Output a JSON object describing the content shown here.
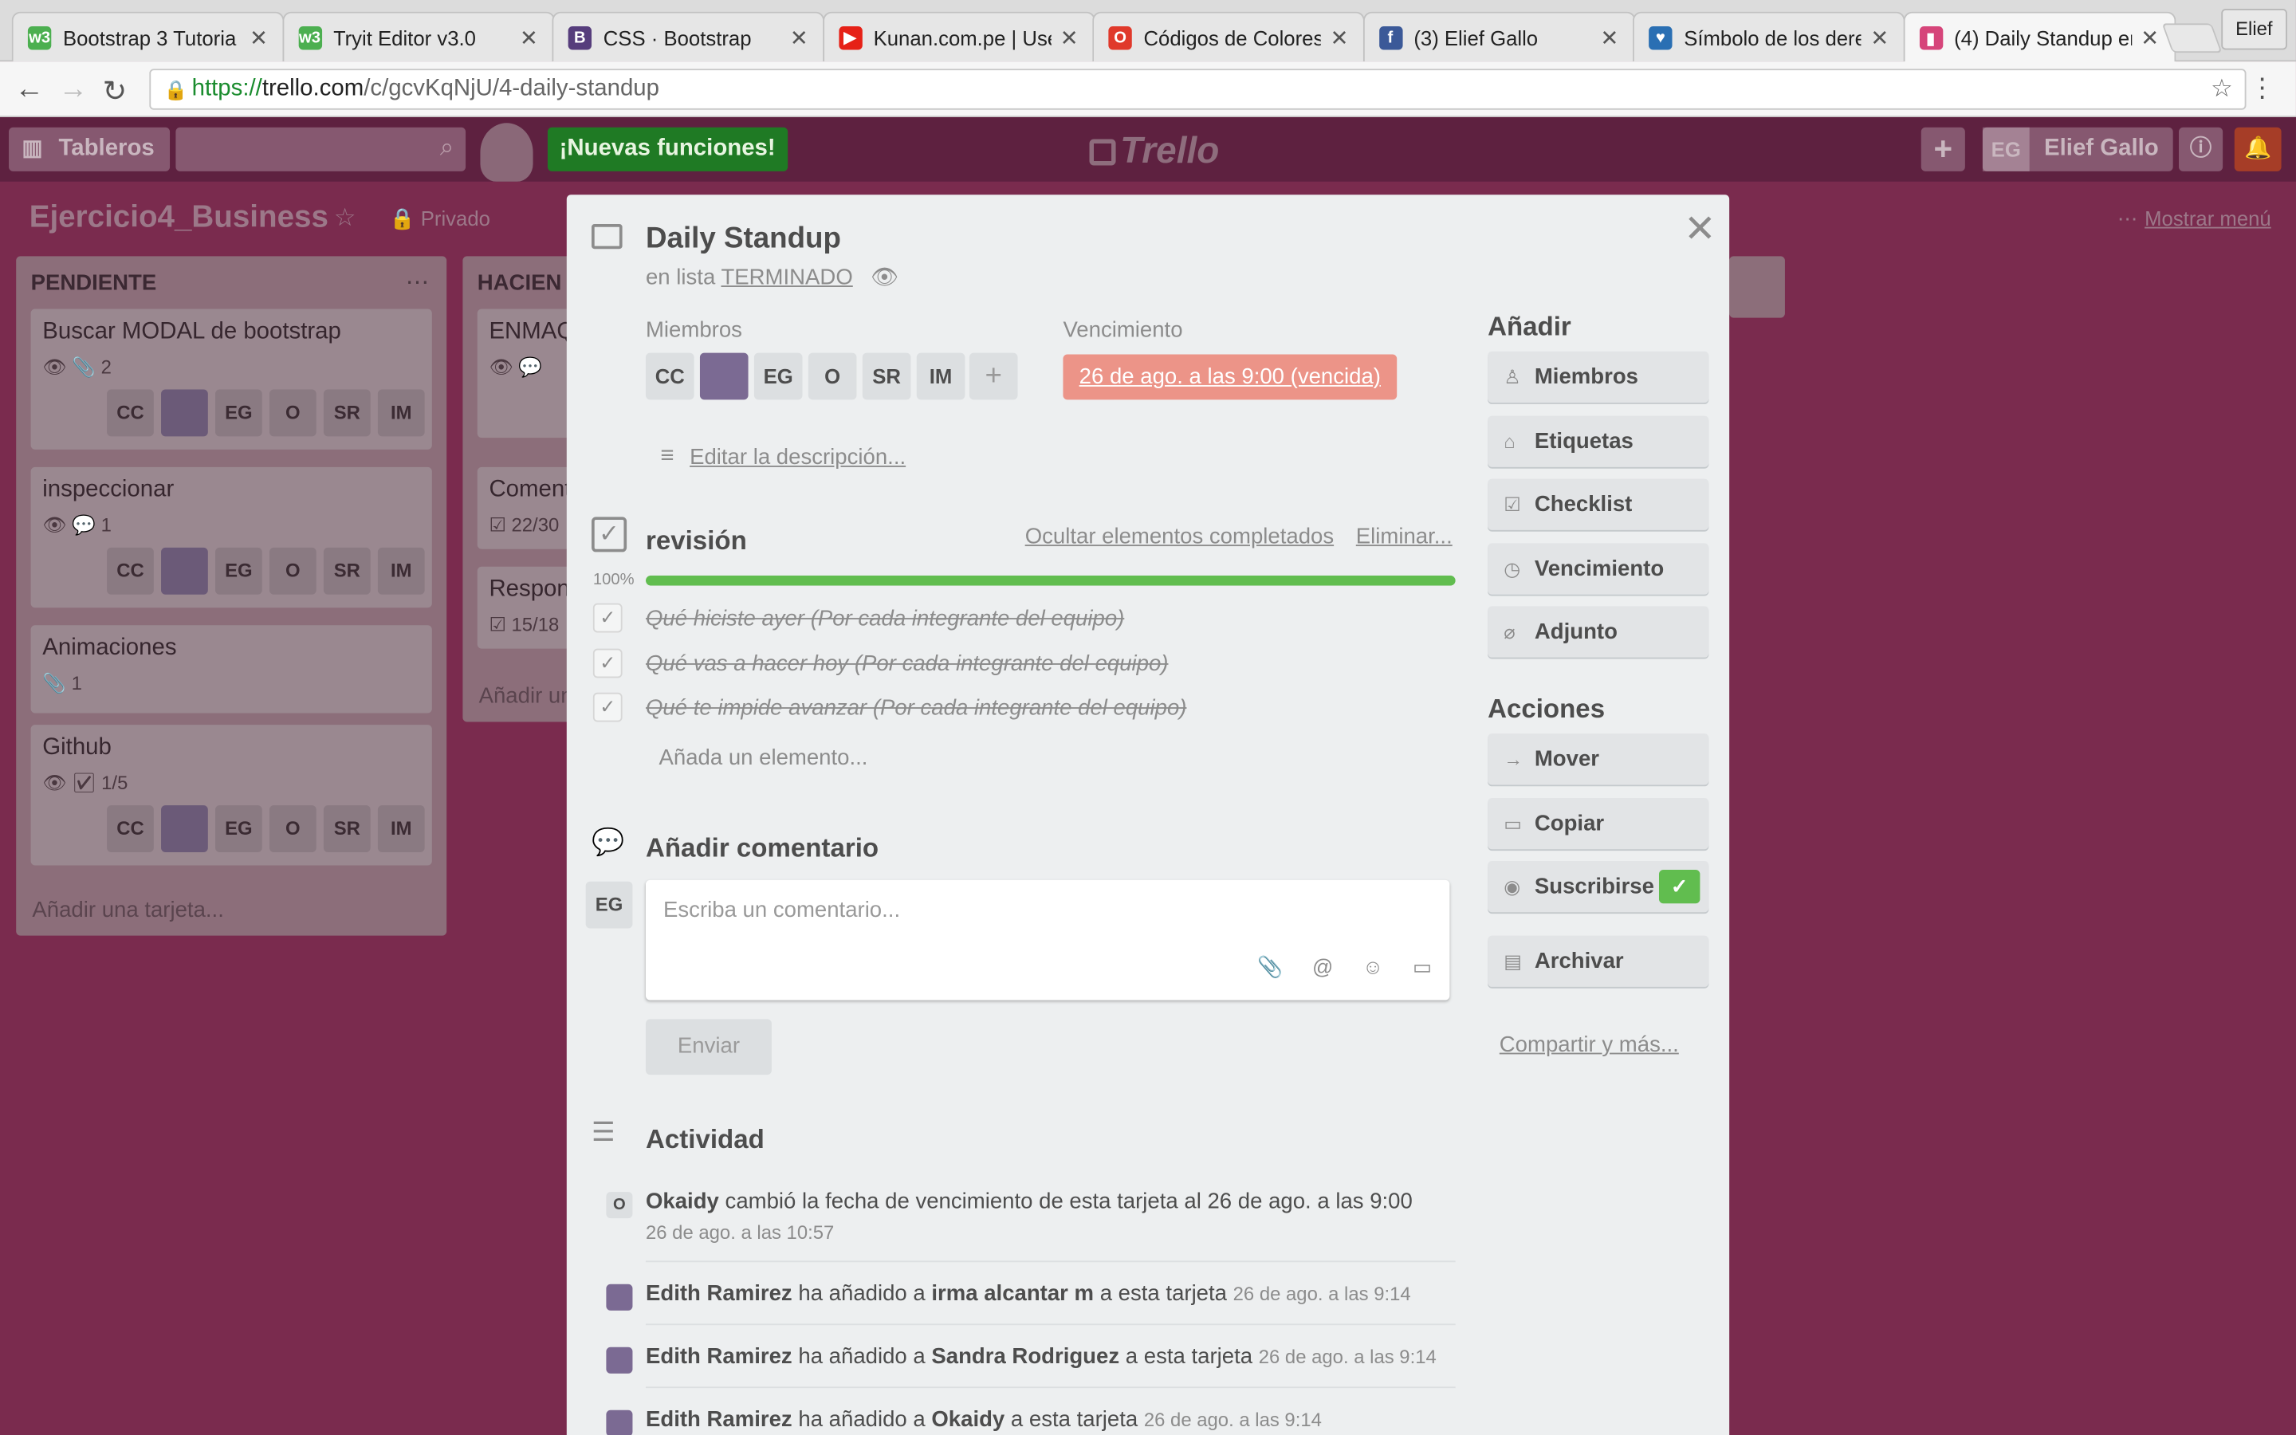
{
  "browser": {
    "tabs": [
      {
        "label": "Bootstrap 3 Tutoria",
        "icon": "w3schools-icon",
        "color": "#4caf50",
        "glyph": "w3"
      },
      {
        "label": "Tryit Editor v3.0",
        "icon": "w3schools-icon",
        "color": "#4caf50",
        "glyph": "w3"
      },
      {
        "label": "CSS · Bootstrap",
        "icon": "bootstrap-icon",
        "color": "#563d7c",
        "glyph": "B"
      },
      {
        "label": "Kunan.com.pe | Use",
        "icon": "youtube-icon",
        "color": "#e62117",
        "glyph": "▶"
      },
      {
        "label": "Códigos de Colores",
        "icon": "opera-icon",
        "color": "#e0392b",
        "glyph": "O"
      },
      {
        "label": "(3) Elief Gallo",
        "icon": "facebook-icon",
        "color": "#3b5998",
        "glyph": "f"
      },
      {
        "label": "Símbolo de los dere",
        "icon": "heart-icon",
        "color": "#2a6fb3",
        "glyph": "♥"
      },
      {
        "label": "(4) Daily Standup er",
        "icon": "trello-icon",
        "color": "#d6457a",
        "glyph": "▮"
      }
    ],
    "profile": "Elief",
    "url": {
      "scheme": "https://",
      "host": "trello.com",
      "path": "/c/gcvKqNjU/4-daily-standup"
    }
  },
  "header": {
    "boards_label": "Tableros",
    "new_features": "¡Nuevas funciones!",
    "logo": "Trello",
    "user_initials": "EG",
    "user_name": "Elief Gallo"
  },
  "board": {
    "title": "Ejercicio4_Business",
    "privacy": "Privado",
    "show_menu": "Mostrar menú",
    "lists": [
      {
        "title": "PENDIENTE",
        "cards": [
          {
            "title": "Buscar MODAL de bootstrap",
            "badges": "👁 📎 2"
          },
          {
            "title": "inspeccionar",
            "badges": "👁 💬 1"
          },
          {
            "title": "Animaciones",
            "badges": "📎 1"
          },
          {
            "title": "Github",
            "badges": "👁 ☑ 1/5"
          }
        ],
        "add_card": "Añadir una tarjeta..."
      },
      {
        "title": "HACIEN",
        "cards": [
          {
            "title": "ENMAQ",
            "badges": "👁 💬"
          },
          {
            "title": "Coment",
            "badges": "☑ 22/30"
          },
          {
            "title": "Respon",
            "badges": "☑ 15/18"
          }
        ],
        "add_card": "Añadir un"
      }
    ],
    "member_chips": [
      "CC",
      "",
      "EG",
      "O",
      "SR",
      "IM"
    ]
  },
  "modal": {
    "title": "Daily Standup",
    "list_prefix": "en lista",
    "list_name": "TERMINADO",
    "members_label": "Miembros",
    "members": [
      "CC",
      "",
      "EG",
      "O",
      "SR",
      "IM"
    ],
    "add_member": "+",
    "due_label": "Vencimiento",
    "due_value": "26 de ago. a las 9:00 (vencida)",
    "edit_description": "Editar la descripción...",
    "checklist": {
      "title": "revisión",
      "hide_completed": "Ocultar elementos completados",
      "delete": "Eliminar...",
      "progress_label": "100%",
      "progress": 1.0,
      "items": [
        "Qué hiciste ayer (Por cada integrante del equipo)",
        "Qué vas a hacer hoy (Por cada integrante del equipo)",
        "Qué te impide avanzar (Por cada integrante del equipo)"
      ],
      "add_item": "Añada un elemento..."
    },
    "comment": {
      "title": "Añadir comentario",
      "author_initials": "EG",
      "placeholder": "Escriba un comentario...",
      "send": "Enviar"
    },
    "activity": {
      "title": "Actividad",
      "entries": [
        {
          "user": "Okaidy",
          "initials": "O",
          "text": "cambió la fecha de vencimiento de esta tarjeta al 26 de ago. a las 9:00",
          "time": "26 de ago. a las 10:57"
        },
        {
          "user": "Edith Ramirez",
          "text": "ha añadido a",
          "target": "irma alcantar m",
          "suffix": "a esta tarjeta",
          "time": "26 de ago. a las 9:14"
        },
        {
          "user": "Edith Ramirez",
          "text": "ha añadido a",
          "target": "Sandra Rodriguez",
          "suffix": "a esta tarjeta",
          "time": "26 de ago. a las 9:14"
        },
        {
          "user": "Edith Ramirez",
          "text": "ha añadido a",
          "target": "Okaidy",
          "suffix": "a esta tarjeta",
          "time": "26 de ago. a las 9:14"
        }
      ]
    },
    "sidebar": {
      "add_title": "Añadir",
      "add_buttons": [
        {
          "label": "Miembros",
          "icon": "person-icon",
          "glyph": "♙"
        },
        {
          "label": "Etiquetas",
          "icon": "tag-icon",
          "glyph": "⌂"
        },
        {
          "label": "Checklist",
          "icon": "checkbox-icon",
          "glyph": "☑"
        },
        {
          "label": "Vencimiento",
          "icon": "clock-icon",
          "glyph": "◷"
        },
        {
          "label": "Adjunto",
          "icon": "paperclip-icon",
          "glyph": "⌀"
        }
      ],
      "actions_title": "Acciones",
      "action_buttons": [
        {
          "label": "Mover",
          "icon": "arrow-right-icon",
          "glyph": "→"
        },
        {
          "label": "Copiar",
          "icon": "card-icon",
          "glyph": "▭"
        },
        {
          "label": "Suscribirse",
          "icon": "eye-icon",
          "glyph": "◉"
        },
        {
          "label": "Archivar",
          "icon": "archive-icon",
          "glyph": "▤"
        }
      ],
      "subscribed_check": "✓",
      "share": "Compartir y más..."
    }
  }
}
